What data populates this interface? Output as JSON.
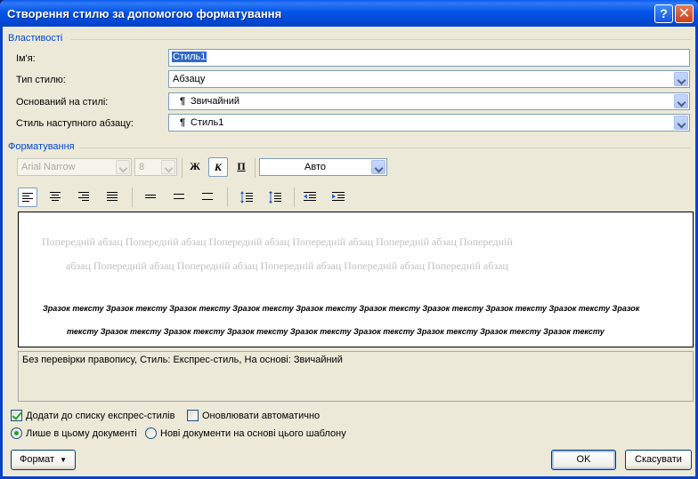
{
  "window": {
    "title": "Створення стилю за допомогою форматування",
    "help_label": "?",
    "close_label": "✕"
  },
  "properties": {
    "group_label": "Властивості",
    "name_label": "Ім'я:",
    "name_value": "Стиль1",
    "style_type_label": "Тип стилю:",
    "style_type_value": "Абзацу",
    "based_on_label": "Оснований на стилі:",
    "based_on_value": "Звичайний",
    "next_style_label": "Стиль наступного абзацу:",
    "next_style_value": "Стиль1",
    "paragraph_mark": "¶"
  },
  "formatting": {
    "group_label": "Форматування",
    "font_name": "Arial Narrow",
    "font_size": "8",
    "bold_label": "Ж",
    "italic_label": "К",
    "underline_label": "П",
    "color_value": "Авто"
  },
  "preview": {
    "prev_line1": "Попередній абзац Попередній абзац Попередній абзац Попередній абзац Попередній абзац Попередній",
    "prev_line2": "абзац Попередній абзац Попередній абзац Попередній абзац Попередній абзац Попередній абзац",
    "sample_line1": "Зразок тексту Зразок тексту Зразок тексту Зразок тексту Зразок тексту Зразок тексту Зразок тексту Зразок тексту Зразок тексту Зразок",
    "sample_line2": "тексту Зразок тексту Зразок тексту Зразок тексту Зразок тексту Зразок тексту Зразок тексту Зразок тексту Зразок тексту"
  },
  "description": "Без перевірки правопису, Стиль: Експрес-стиль, На основі: Звичайний",
  "options": {
    "add_quick_label": "Додати до списку експрес-стилів",
    "add_quick_checked": true,
    "auto_update_label": "Оновлювати автоматично",
    "auto_update_checked": false,
    "this_doc_label": "Лише в цьому документі",
    "new_docs_label": "Нові документи на основі цього шаблону"
  },
  "buttons": {
    "format_label": "Формат",
    "ok_label": "OK",
    "cancel_label": "Скасувати"
  },
  "colors": {
    "titlebar": "#0355e8",
    "dialog_bg": "#ece9d8",
    "group_label": "#0046d5",
    "check_green": "#21a121"
  }
}
